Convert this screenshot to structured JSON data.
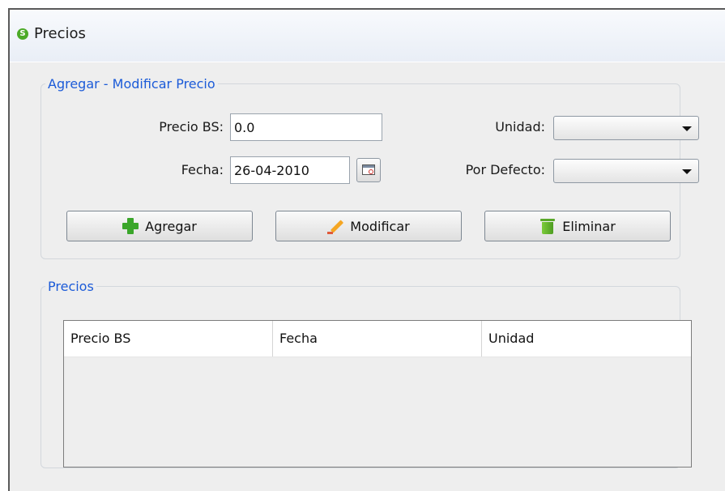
{
  "window": {
    "title": "Precios",
    "app_icon_letter": "S"
  },
  "form": {
    "legend": "Agregar - Modificar Precio",
    "precio_label": "Precio BS:",
    "precio_value": "0.0",
    "fecha_label": "Fecha:",
    "fecha_value": "26-04-2010",
    "unidad_label": "Unidad:",
    "unidad_value": "",
    "defecto_label": "Por Defecto:",
    "defecto_value": ""
  },
  "buttons": {
    "agregar": "Agregar",
    "modificar": "Modificar",
    "eliminar": "Eliminar"
  },
  "table": {
    "legend": "Precios",
    "columns": [
      "Precio BS",
      "Fecha",
      "Unidad"
    ],
    "rows": []
  },
  "icons": {
    "app": "app-logo-icon",
    "calendar": "calendar-icon",
    "add": "plus-icon",
    "edit": "pencil-icon",
    "delete": "trash-icon"
  },
  "colors": {
    "legend_text": "#1c5bd8",
    "add_icon": "#3aa62a",
    "window_bg": "#eeeeee"
  }
}
